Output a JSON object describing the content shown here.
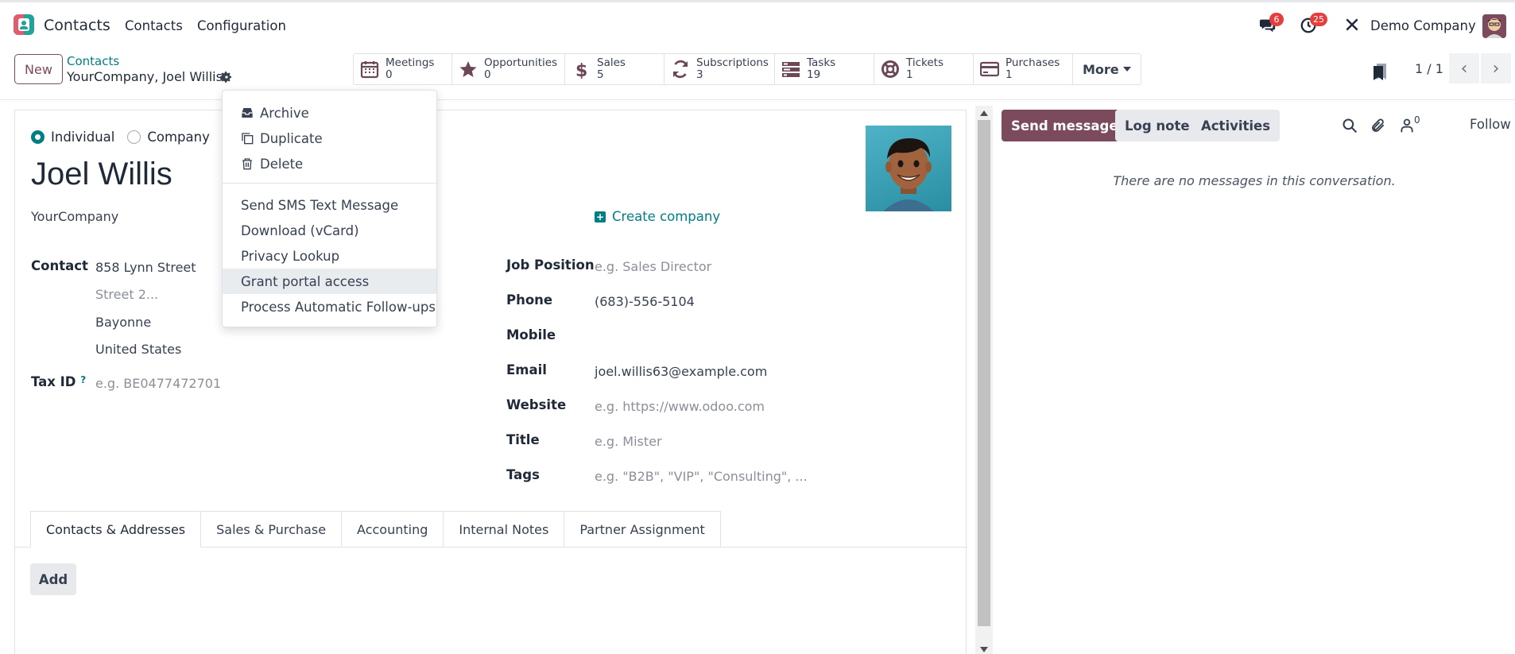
{
  "topbar": {
    "app_title": "Contacts",
    "nav": [
      "Contacts",
      "Configuration"
    ],
    "messages_badge": "6",
    "activities_badge": "25",
    "company": "Demo Company"
  },
  "control_panel": {
    "new_label": "New",
    "breadcrumb_parent": "Contacts",
    "breadcrumb_current": "YourCompany, Joel Willis",
    "smart_buttons": [
      {
        "label": "Meetings",
        "value": "0",
        "icon": "calendar-icon"
      },
      {
        "label": "Opportunities",
        "value": "0",
        "icon": "star-icon"
      },
      {
        "label": "Sales",
        "value": "5",
        "icon": "dollar-icon"
      },
      {
        "label": "Subscriptions",
        "value": "3",
        "icon": "refresh-icon"
      },
      {
        "label": "Tasks",
        "value": "19",
        "icon": "tasks-icon"
      },
      {
        "label": "Tickets",
        "value": "1",
        "icon": "lifebuoy-icon"
      },
      {
        "label": "Purchases",
        "value": "1",
        "icon": "credit-card-icon"
      }
    ],
    "more_label": "More",
    "pager": "1 / 1"
  },
  "form": {
    "type_options": [
      "Individual",
      "Company"
    ],
    "selected_type": "Individual",
    "name": "Joel Willis",
    "company": "YourCompany",
    "create_company_label": "Create company",
    "contact_label": "Contact",
    "address": {
      "street": "858 Lynn Street",
      "street2_placeholder": "Street 2...",
      "city": "Bayonne",
      "country": "United States"
    },
    "tax_id_label": "Tax ID",
    "tax_id_tooltip": "?",
    "tax_id_placeholder": "e.g. BE0477472701",
    "job_position_label": "Job Position",
    "job_position_placeholder": "e.g. Sales Director",
    "phone_label": "Phone",
    "phone": "(683)-556-5104",
    "mobile_label": "Mobile",
    "email_label": "Email",
    "email": "joel.willis63@example.com",
    "website_label": "Website",
    "website_placeholder": "e.g. https://www.odoo.com",
    "title_label": "Title",
    "title_placeholder": "e.g. Mister",
    "tags_label": "Tags",
    "tags_placeholder": "e.g. \"B2B\", \"VIP\", \"Consulting\", ...",
    "tabs": [
      "Contacts & Addresses",
      "Sales & Purchase",
      "Accounting",
      "Internal Notes",
      "Partner Assignment"
    ],
    "active_tab": "Contacts & Addresses",
    "add_label": "Add"
  },
  "gear_menu": {
    "items_top": [
      {
        "label": "Archive",
        "icon": "archive-icon"
      },
      {
        "label": "Duplicate",
        "icon": "copy-icon"
      },
      {
        "label": "Delete",
        "icon": "trash-icon"
      }
    ],
    "items_bottom": [
      "Send SMS Text Message",
      "Download (vCard)",
      "Privacy Lookup",
      "Grant portal access",
      "Process Automatic Follow-ups"
    ],
    "hovered": "Grant portal access"
  },
  "chatter": {
    "send_message": "Send message",
    "log_note": "Log note",
    "activities": "Activities",
    "followers_count": "0",
    "follow": "Follow",
    "empty": "There are no messages in this conversation."
  },
  "colors": {
    "brand": "#7b4a5c",
    "accent": "#017e84",
    "badge": "#e53e3e"
  }
}
